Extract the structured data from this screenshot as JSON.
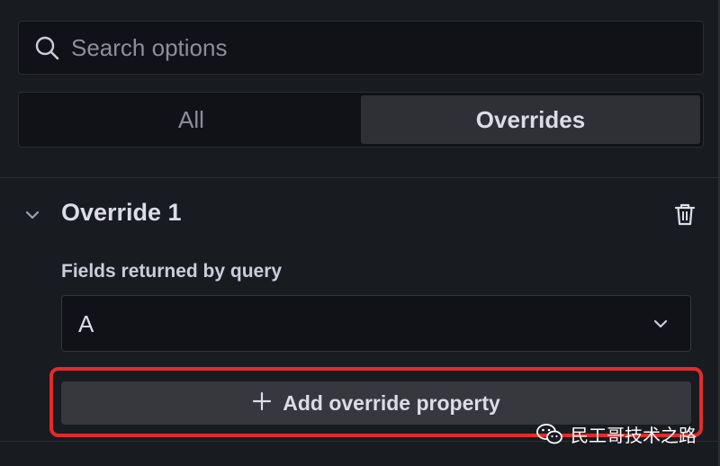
{
  "search": {
    "placeholder": "Search options",
    "icon": "search-icon"
  },
  "tabs": [
    {
      "label": "All",
      "active": false
    },
    {
      "label": "Overrides",
      "active": true
    }
  ],
  "override": {
    "title": "Override 1",
    "collapse_icon": "chevron-down-icon",
    "delete_icon": "trash-icon"
  },
  "matcher": {
    "label": "Fields returned by query",
    "value": "A",
    "dropdown_icon": "chevron-down-icon"
  },
  "add_property": {
    "label": "Add override property",
    "icon": "plus-icon"
  },
  "watermark": {
    "text": "民工哥技术之路",
    "icon": "wechat-icon"
  },
  "colors": {
    "background": "#181b1f",
    "input_bg": "#111217",
    "active_tab": "#2f3035",
    "button_bg": "#36383e",
    "highlight": "#e32b2b"
  }
}
